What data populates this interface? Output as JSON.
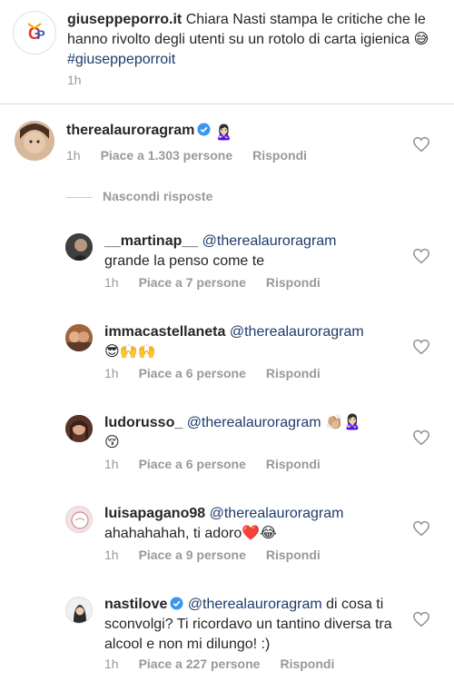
{
  "post": {
    "username": "giuseppeporro.it",
    "caption": "Chiara Nasti stampa le critiche che le hanno rivolto degli utenti su un rotolo di carta igienica",
    "caption_emoji": "😅",
    "hashtag": "#giuseppeporroit",
    "time": "1h"
  },
  "main_comment": {
    "username": "therealauroragram",
    "emoji": "🙎🏻‍♀️",
    "time": "1h",
    "likes": "Piace a 1.303 persone",
    "reply": "Rispondi"
  },
  "hide_replies": "Nascondi risposte",
  "replies": [
    {
      "username": "__martinap__",
      "mention": "@therealauroragram",
      "text": "grande la penso come te",
      "time": "1h",
      "likes": "Piace a 7 persone",
      "reply": "Rispondi"
    },
    {
      "username": "immacastellaneta",
      "mention": "@therealauroragram",
      "text": "😎🙌🙌",
      "time": "1h",
      "likes": "Piace a 6 persone",
      "reply": "Rispondi"
    },
    {
      "username": "ludorusso_",
      "mention": "@therealauroragram",
      "text_inline": "👏🏼🙎🏻‍♀️",
      "text": "😚",
      "time": "1h",
      "likes": "Piace a 6 persone",
      "reply": "Rispondi"
    },
    {
      "username": "luisapagano98",
      "mention": "@therealauroragram",
      "text": "ahahahahah, ti adoro❤️😂",
      "time": "1h",
      "likes": "Piace a 9 persone",
      "reply": "Rispondi"
    },
    {
      "username": "nastilove",
      "mention": "@therealauroragram",
      "text_inline": "di cosa",
      "text": "ti sconvolgi? Ti ricordavo un tantino diversa tra alcool e non mi dilungo! :)",
      "time": "1h",
      "likes": "Piace a 227 persone",
      "reply": "Rispondi"
    }
  ],
  "colors": {
    "link": "#1e3a6b",
    "meta": "#999999",
    "verified": "#3897f0",
    "divider": "#dbdbdb"
  }
}
